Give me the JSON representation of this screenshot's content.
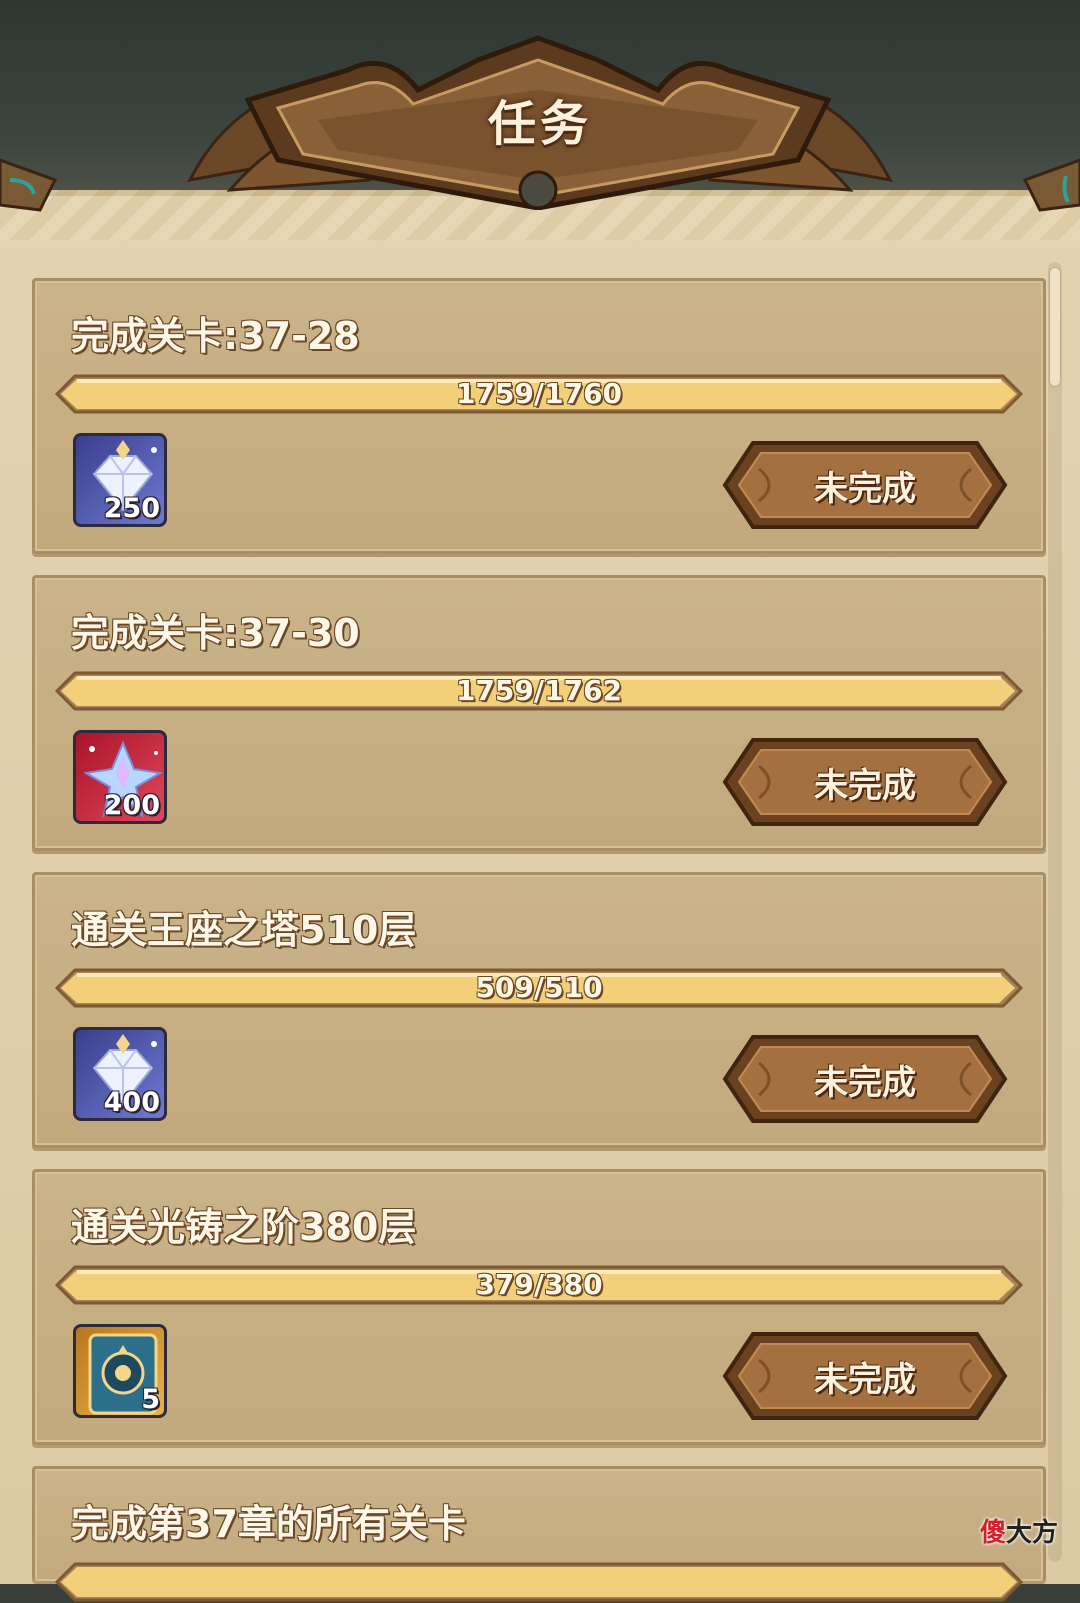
{
  "header": {
    "title": "任务"
  },
  "tasks": [
    {
      "title": "完成关卡:37-28",
      "progress_text": "1759/1760",
      "progress": 0.9994,
      "reward": {
        "icon": "diamond-icon",
        "count": "250"
      },
      "button_label": "未完成"
    },
    {
      "title": "完成关卡:37-30",
      "progress_text": "1759/1762",
      "progress": 0.9983,
      "reward": {
        "icon": "crystal-shard-icon",
        "count": "200"
      },
      "button_label": "未完成"
    },
    {
      "title": "通关王座之塔510层",
      "progress_text": "509/510",
      "progress": 0.998,
      "reward": {
        "icon": "diamond-icon",
        "count": "400"
      },
      "button_label": "未完成"
    },
    {
      "title": "通关光铸之阶380层",
      "progress_text": "379/380",
      "progress": 0.9974,
      "reward": {
        "icon": "card-token-icon",
        "count": "5"
      },
      "button_label": "未完成"
    },
    {
      "title": "完成第37章的所有关卡"
    }
  ],
  "watermark": {
    "part1": "傻",
    "part2": "大方"
  },
  "colors": {
    "parchment": "#dccaa4",
    "card": "#c6ad80",
    "bar_fill": "#f2cf78",
    "button": "#9a6a3c"
  }
}
